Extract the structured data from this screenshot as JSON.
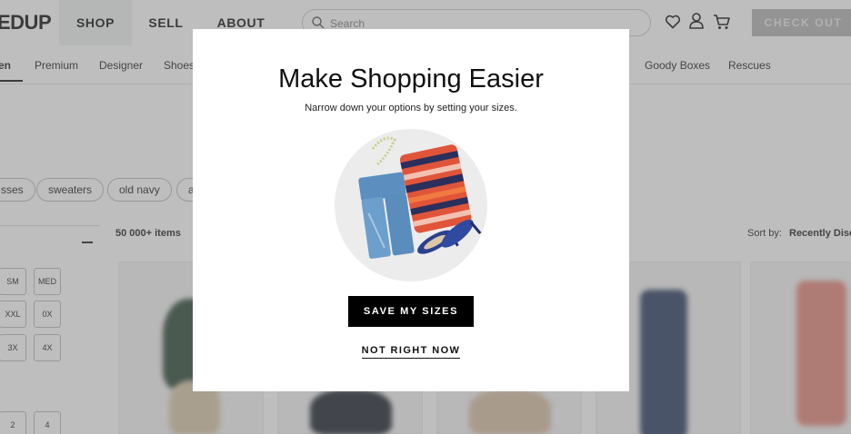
{
  "header": {
    "logo": "EDUP",
    "nav": [
      {
        "label": "SHOP"
      },
      {
        "label": "SELL"
      },
      {
        "label": "ABOUT"
      }
    ],
    "search_placeholder": "Search",
    "checkout_label": "CHECK OUT"
  },
  "categories": {
    "items": [
      {
        "label": "en"
      },
      {
        "label": "Premium"
      },
      {
        "label": "Designer"
      },
      {
        "label": "Shoes"
      },
      {
        "label": "Goody Boxes"
      },
      {
        "label": "Rescues"
      }
    ]
  },
  "chips": [
    {
      "label": "sses"
    },
    {
      "label": "sweaters"
    },
    {
      "label": "old navy"
    },
    {
      "label": "a"
    }
  ],
  "results": {
    "count": "50 000+ items",
    "sort_label": "Sort by:",
    "sort_value": "Recently Disc"
  },
  "sizes": [
    "SM",
    "MED",
    "XXL",
    "0X",
    "3X",
    "4X",
    "2",
    "4"
  ],
  "modal": {
    "title": "Make Shopping Easier",
    "subtitle": "Narrow down your options by setting your sizes.",
    "save_label": "SAVE MY SIZES",
    "dismiss_label": "NOT RIGHT NOW"
  },
  "colors": {
    "overlay": "#6e6e6e",
    "primary_button": "#000000",
    "checkout_disabled": "#b3b3b3",
    "active_nav_bg": "#eef0f0"
  }
}
